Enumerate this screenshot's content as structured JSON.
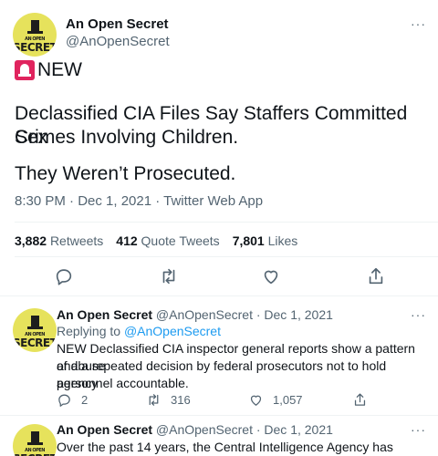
{
  "tweet": {
    "author": "An Open Secret",
    "handle": "@AnOpenSecret",
    "avatar_text_small": "AN OPEN",
    "avatar_text_big": "SECRET",
    "badge_icon": "siren-icon",
    "badge_text": "NEW",
    "body_line1": "Declassified CIA Files Say Staffers Committed Sex",
    "body_line2": "Crimes Involving Children.",
    "body_line3": "They Weren’t Prosecuted.",
    "meta": "8:30 PM · Dec 1, 2021 · Twitter Web App",
    "stats": [
      {
        "count": "3,882",
        "label": "Retweets"
      },
      {
        "count": "412",
        "label": "Quote Tweets"
      },
      {
        "count": "7,801",
        "label": "Likes"
      }
    ],
    "more": "···"
  },
  "replies": [
    {
      "author": "An Open Secret",
      "handle_date": "@AnOpenSecret · Dec 1, 2021",
      "replying_prefix": "Replying to ",
      "replying_to": "@AnOpenSecret",
      "lines": [
        "NEW Declassified CIA inspector general reports show a pattern of abuse",
        "and a repeated decision by federal prosecutors not to hold agency",
        "personnel accountable."
      ],
      "reply_count": "2",
      "retweet_count": "316",
      "like_count": "1,057"
    },
    {
      "author": "An Open Secret",
      "handle_date": "@AnOpenSecret · Dec 1, 2021",
      "lines": [
        "Over the past 14 years, the Central Intelligence Agency has secretly"
      ]
    }
  ],
  "colors": {
    "accent": "#1d9bf0",
    "secondary_text": "#536471",
    "avatar_bg": "#e6e25c",
    "badge": "#e0245e"
  }
}
